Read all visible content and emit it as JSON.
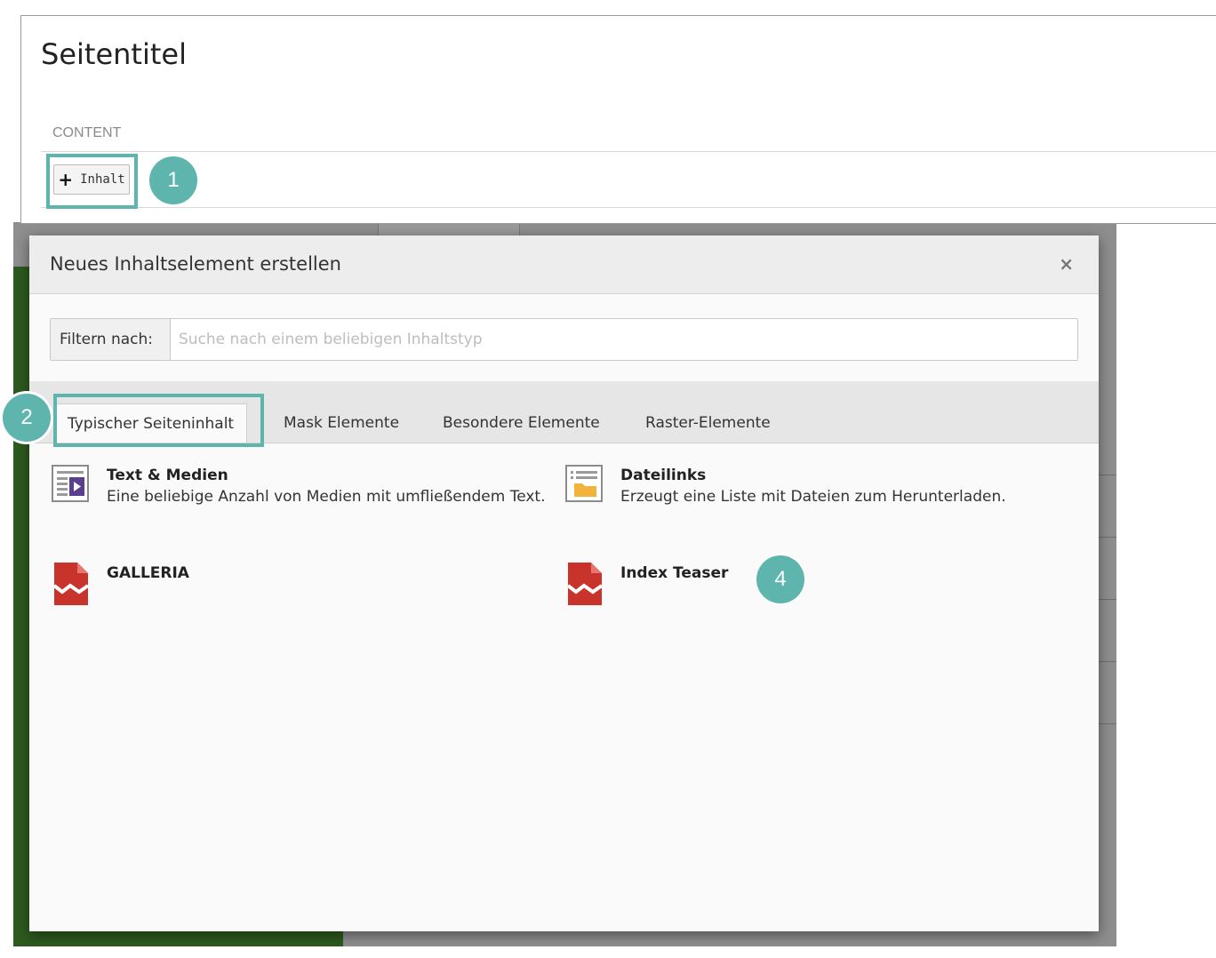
{
  "page": {
    "title": "Seitentitel",
    "column_label": "CONTENT",
    "add_button_label": "Inhalt"
  },
  "callouts": [
    "1",
    "2",
    "4"
  ],
  "modal": {
    "title": "Neues Inhaltselement erstellen",
    "close_symbol": "×",
    "filter": {
      "label": "Filtern nach:",
      "placeholder": "Suche nach einem beliebigen Inhaltstyp",
      "value": ""
    },
    "tabs": [
      {
        "label": "Typischer Seiteninhalt",
        "active": true
      },
      {
        "label": "Mask Elemente",
        "active": false
      },
      {
        "label": "Besondere Elemente",
        "active": false
      },
      {
        "label": "Raster-Elemente",
        "active": false
      }
    ],
    "items": [
      {
        "title": "Text & Medien",
        "description": "Eine beliebige Anzahl von Medien mit umfließendem Text.",
        "icon": "text-media-icon"
      },
      {
        "title": "Dateilinks",
        "description": "Erzeugt eine Liste mit Dateien zum Herunterladen.",
        "icon": "file-links-icon"
      },
      {
        "title": "GALLERIA",
        "description": "",
        "icon": "plugin-icon"
      },
      {
        "title": "Index Teaser",
        "description": "",
        "icon": "plugin-icon"
      }
    ]
  },
  "colors": {
    "accent": "#5db5ad",
    "plugin_red": "#c8332b",
    "media_purple": "#5a3f8f",
    "folder_yellow": "#f3b23c"
  }
}
